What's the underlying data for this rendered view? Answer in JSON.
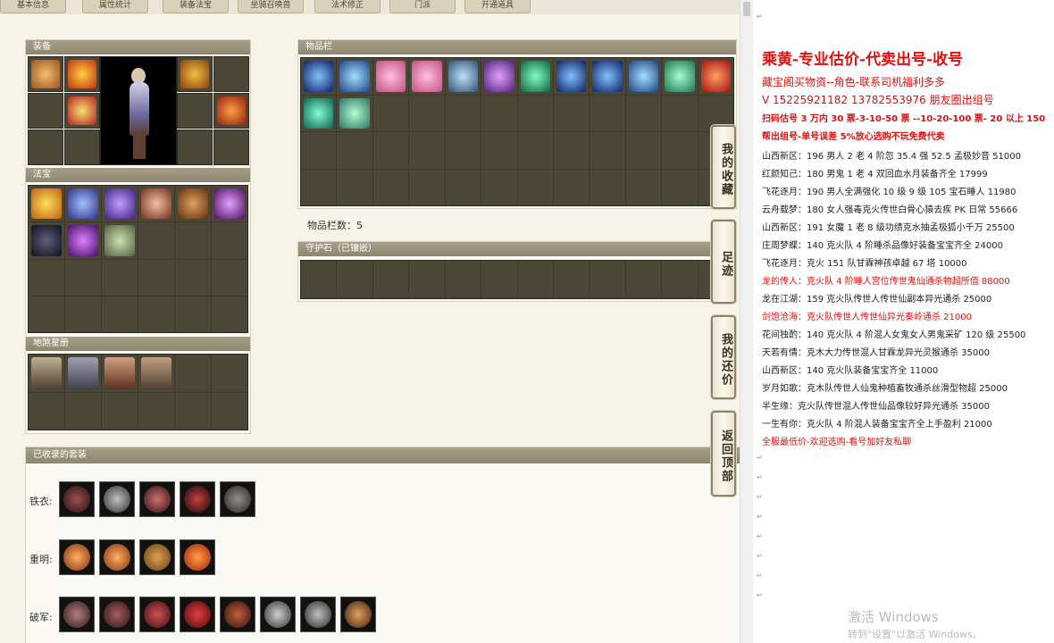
{
  "tabs": [
    "基本信息",
    "属性统计",
    "装备法宝",
    "坐骑召唤兽",
    "法术修正",
    "门派",
    "开通道具"
  ],
  "equipment": {
    "title": "装备"
  },
  "treasure": {
    "title": "法宝"
  },
  "earth_card": {
    "title": "地煞星册"
  },
  "inventory": {
    "title": "物品栏",
    "count_label": "物品栏数：5"
  },
  "guard_stone": {
    "title": "守护石（已镶嵌）"
  },
  "suits": {
    "title": "已收录的套装",
    "rows": [
      {
        "label": "铁衣:",
        "count": 5
      },
      {
        "label": "重明:",
        "count": 4
      },
      {
        "label": "破军:",
        "count": 8
      }
    ]
  },
  "side_buttons": [
    "我的收藏",
    "足迹",
    "我的还价",
    "返回顶部"
  ],
  "ad": {
    "headline": "乘黄-专业估价-代卖出号-收号",
    "subtitle": "藏宝阁买物资--角色-联系司机福利多多",
    "contact": "V 15225921182    13782553976 朋友圈出组号",
    "price_line": "扫码估号 3 万内 30 票-3-10-50 票 --10-20-100 票- 20 以上 150",
    "promise_line": "帮出组号-单号误差 5%放心选购不玩免费代卖",
    "listings": [
      {
        "text": "山西新区：196 男人 2 老 4 阶忽 35.4 强 52.5 孟极妙音 51000",
        "red": false
      },
      {
        "text": "红颜知己：180 男鬼 1 老 4 双回血水月装备齐全 17999",
        "red": false
      },
      {
        "text": "飞花逐月：190 男人全满强化 10 级 9 级 105 宝石睡人 11980",
        "red": false
      },
      {
        "text": "云舟载梦：180 女人强毒克火传世白骨心猿去疾 PK 日常 55666",
        "red": false
      },
      {
        "text": "山西新区：191 女魔 1 老 8 级功绩克水抽孟极狐小千万 25500",
        "red": false
      },
      {
        "text": "庄周梦蝶：140 克火队 4 阶睡杀品像好装备宝宝齐全 24000",
        "red": false
      },
      {
        "text": "飞花逐月：克火 151 队甘霖神孩卓越 67 塔 10000",
        "red": false
      },
      {
        "text": "龙的传人：克火队 4 阶睡人宫位传世鬼仙通杀物超所值 88000",
        "red": true
      },
      {
        "text": "龙在江湖：159 克火队传世人传世仙副本异光通杀 25000",
        "red": false
      },
      {
        "text": "剑饱沧海：克火队传世人传世仙异光秦岭通杀 21000",
        "red": true
      },
      {
        "text": "花间独酌：140 克火队 4 阶混人女鬼女人男鬼采矿 120 级 25500",
        "red": false
      },
      {
        "text": "天若有情：克木大力传世混人甘霖龙异光灵猴通杀 35000",
        "red": false
      },
      {
        "text": "山西新区：140 克火队装备宝宝齐全 11000",
        "red": false
      },
      {
        "text": "岁月如歌：克木队传世人仙鬼种植畜牧通杀丝滑型物超 25000",
        "red": false
      },
      {
        "text": "半生缘：克火队传世混人传世仙品像较好异光通杀 35000",
        "red": false
      },
      {
        "text": "一生有你：克火队 4 阶混人装备宝宝齐全上手盈利 21000",
        "red": false
      },
      {
        "text": "全服最低价-欢迎选购-看号加好友私聊",
        "red": true
      }
    ]
  },
  "windows_watermark": {
    "line1": "激活 Windows",
    "line2": "转到\"设置\"以激活 Windows。"
  },
  "colors": {
    "panel_header": "#8e8670",
    "grid_bg": "#4a4736",
    "ad_red": "#e01010"
  }
}
